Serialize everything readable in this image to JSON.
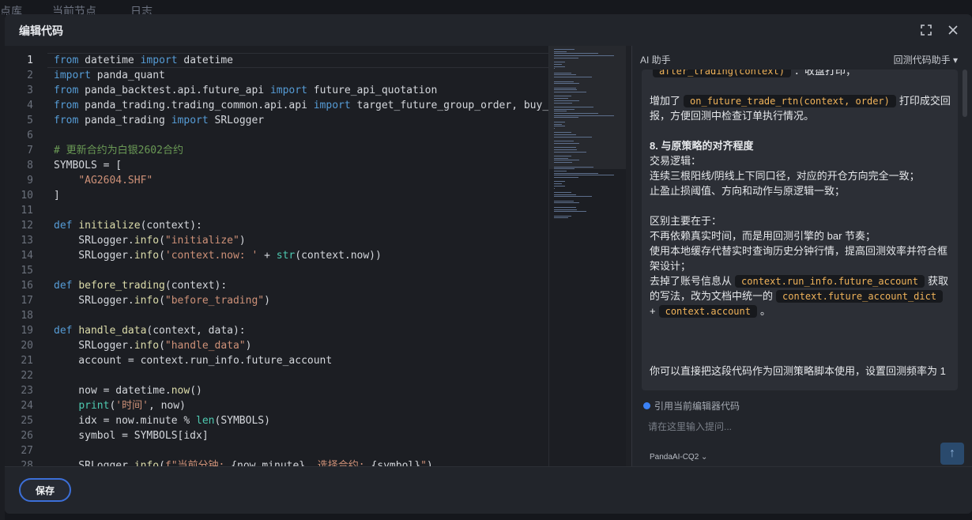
{
  "background_tabs": [
    "点库",
    "当前节点",
    "日志"
  ],
  "modal": {
    "title": "编辑代码",
    "fullscreen_icon": "fullscreen-icon",
    "close_icon": "close-icon"
  },
  "editor": {
    "active_line": 1,
    "lines": [
      [
        {
          "t": "from",
          "c": "kw"
        },
        {
          "t": " datetime "
        },
        {
          "t": "import",
          "c": "kw"
        },
        {
          "t": " datetime"
        }
      ],
      [
        {
          "t": "import",
          "c": "kw"
        },
        {
          "t": " panda_quant"
        }
      ],
      [
        {
          "t": "from",
          "c": "kw"
        },
        {
          "t": " panda_backtest.api.future_api "
        },
        {
          "t": "import",
          "c": "kw"
        },
        {
          "t": " future_api_quotation"
        }
      ],
      [
        {
          "t": "from",
          "c": "kw"
        },
        {
          "t": " panda_trading.trading_common.api.api "
        },
        {
          "t": "import",
          "c": "kw"
        },
        {
          "t": " target_future_group_order, buy_open"
        }
      ],
      [
        {
          "t": "from",
          "c": "kw"
        },
        {
          "t": " panda_trading "
        },
        {
          "t": "import",
          "c": "kw"
        },
        {
          "t": " SRLogger"
        }
      ],
      [],
      [
        {
          "t": "# 更新合约为白银2602合约",
          "c": "cmt"
        }
      ],
      [
        {
          "t": "SYMBOLS = ["
        }
      ],
      [
        {
          "t": "    "
        },
        {
          "t": "\"AG2604.SHF\"",
          "c": "str"
        }
      ],
      [
        {
          "t": "]"
        }
      ],
      [],
      [
        {
          "t": "def",
          "c": "kw"
        },
        {
          "t": " "
        },
        {
          "t": "initialize",
          "c": "fn"
        },
        {
          "t": "(context):"
        }
      ],
      [
        {
          "t": "    SRLogger."
        },
        {
          "t": "info",
          "c": "fn"
        },
        {
          "t": "("
        },
        {
          "t": "\"initialize\"",
          "c": "str"
        },
        {
          "t": ")"
        }
      ],
      [
        {
          "t": "    SRLogger."
        },
        {
          "t": "info",
          "c": "fn"
        },
        {
          "t": "("
        },
        {
          "t": "'context.now: '",
          "c": "str"
        },
        {
          "t": " + "
        },
        {
          "t": "str",
          "c": "bi"
        },
        {
          "t": "(context.now))"
        }
      ],
      [],
      [
        {
          "t": "def",
          "c": "kw"
        },
        {
          "t": " "
        },
        {
          "t": "before_trading",
          "c": "fn"
        },
        {
          "t": "(context):"
        }
      ],
      [
        {
          "t": "    SRLogger."
        },
        {
          "t": "info",
          "c": "fn"
        },
        {
          "t": "("
        },
        {
          "t": "\"before_trading\"",
          "c": "str"
        },
        {
          "t": ")"
        }
      ],
      [],
      [
        {
          "t": "def",
          "c": "kw"
        },
        {
          "t": " "
        },
        {
          "t": "handle_data",
          "c": "fn"
        },
        {
          "t": "(context, data):"
        }
      ],
      [
        {
          "t": "    SRLogger."
        },
        {
          "t": "info",
          "c": "fn"
        },
        {
          "t": "("
        },
        {
          "t": "\"handle_data\"",
          "c": "str"
        },
        {
          "t": ")"
        }
      ],
      [
        {
          "t": "    account = context.run_info.future_account"
        }
      ],
      [],
      [
        {
          "t": "    now = datetime."
        },
        {
          "t": "now",
          "c": "fn"
        },
        {
          "t": "()"
        }
      ],
      [
        {
          "t": "    "
        },
        {
          "t": "print",
          "c": "bi"
        },
        {
          "t": "("
        },
        {
          "t": "'时间'",
          "c": "str"
        },
        {
          "t": ", now)"
        }
      ],
      [
        {
          "t": "    idx = now.minute % "
        },
        {
          "t": "len",
          "c": "bi"
        },
        {
          "t": "(SYMBOLS)"
        }
      ],
      [
        {
          "t": "    symbol = SYMBOLS[idx]"
        }
      ],
      [],
      [
        {
          "t": "    SRLogger."
        },
        {
          "t": "info",
          "c": "fn"
        },
        {
          "t": "("
        },
        {
          "t": "f\"当前分钟: ",
          "c": "str"
        },
        {
          "t": "{now.minute}"
        },
        {
          "t": ", 选择合约: ",
          "c": "str"
        },
        {
          "t": "{symbol}"
        },
        {
          "t": "\"",
          "c": "str"
        },
        {
          "t": ")"
        }
      ]
    ]
  },
  "ai_panel": {
    "title": "AI 助手",
    "mode": "回测代码助手",
    "message": [
      [
        {
          "code": "after_trading(context)"
        },
        {
          "t": "：收盘打印；"
        }
      ],
      [],
      [
        {
          "t": "增加了"
        },
        {
          "code": "on_future_trade_rtn(context, order)"
        },
        {
          "t": "打印成交回"
        }
      ],
      [
        {
          "t": "报，方便回测中检查订单执行情况。"
        }
      ],
      [],
      [
        {
          "t": "8. 与原策略的对齐程度",
          "b": true
        }
      ],
      [
        {
          "t": "交易逻辑："
        }
      ],
      [
        {
          "t": "连续三根阳线/阴线上下同口径，对应的开仓方向完全一致；"
        }
      ],
      [
        {
          "t": "止盈止损阈值、方向和动作与原逻辑一致；"
        }
      ],
      [],
      [
        {
          "t": "区别主要在于："
        }
      ],
      [
        {
          "t": "不再依赖真实时间，而是用回测引擎的 bar 节奏；"
        }
      ],
      [
        {
          "t": "使用本地缓存代替实时查询历史分钟行情，提高回测效率并符合框"
        }
      ],
      [
        {
          "t": "架设计；"
        }
      ],
      [
        {
          "t": "去掉了账号信息从"
        },
        {
          "code": "context.run_info.future_account"
        },
        {
          "t": "获取"
        }
      ],
      [
        {
          "t": "的写法，改为文档中统一的"
        },
        {
          "code": "context.future_account_dict"
        }
      ],
      [
        {
          "t": "+"
        },
        {
          "code": "context.account"
        },
        {
          "t": "。"
        }
      ],
      [],
      [],
      [],
      [
        {
          "t": "你可以直接把这段代码作为回测策略脚本使用，设置回测频率为 1"
        }
      ]
    ],
    "reference_label": "引用当前编辑器代码",
    "input_placeholder": "请在这里输入提问...",
    "model": "PandaAI-CQ2",
    "send_icon": "arrow-up-icon"
  },
  "footer": {
    "save_label": "保存"
  },
  "colors": {
    "accent": "#3c6fd8",
    "code_chip_text": "#f0b35a",
    "keyword": "#569cd6",
    "string": "#ce9178",
    "comment": "#6a9955"
  }
}
